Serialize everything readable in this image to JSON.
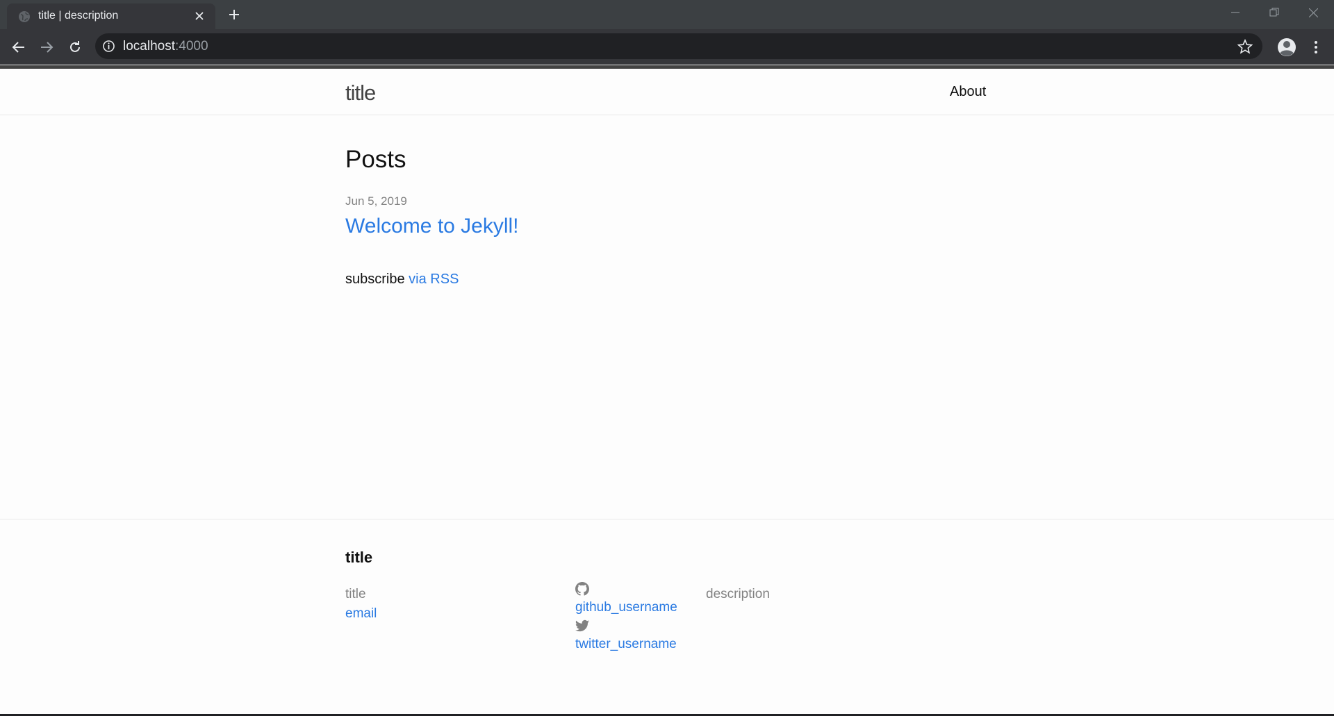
{
  "browser": {
    "tab_title": "title | description",
    "url_host": "localhost",
    "url_port": ":4000",
    "chrome_color": "#3c4043"
  },
  "site": {
    "title": "title",
    "nav": {
      "about": "About"
    }
  },
  "main": {
    "heading": "Posts",
    "posts": [
      {
        "date": "Jun 5, 2019",
        "title": "Welcome to Jekyll!"
      }
    ],
    "rss_prefix": "subscribe",
    "rss_link": "via RSS"
  },
  "footer": {
    "heading": "title",
    "name": "title",
    "email": "email",
    "github_icon": "github-icon",
    "github_username": "github_username",
    "twitter_icon": "twitter-icon",
    "twitter_username": "twitter_username",
    "description": "description"
  },
  "colors": {
    "link": "#2a7ae2",
    "meta": "#828282",
    "text": "#111111"
  }
}
